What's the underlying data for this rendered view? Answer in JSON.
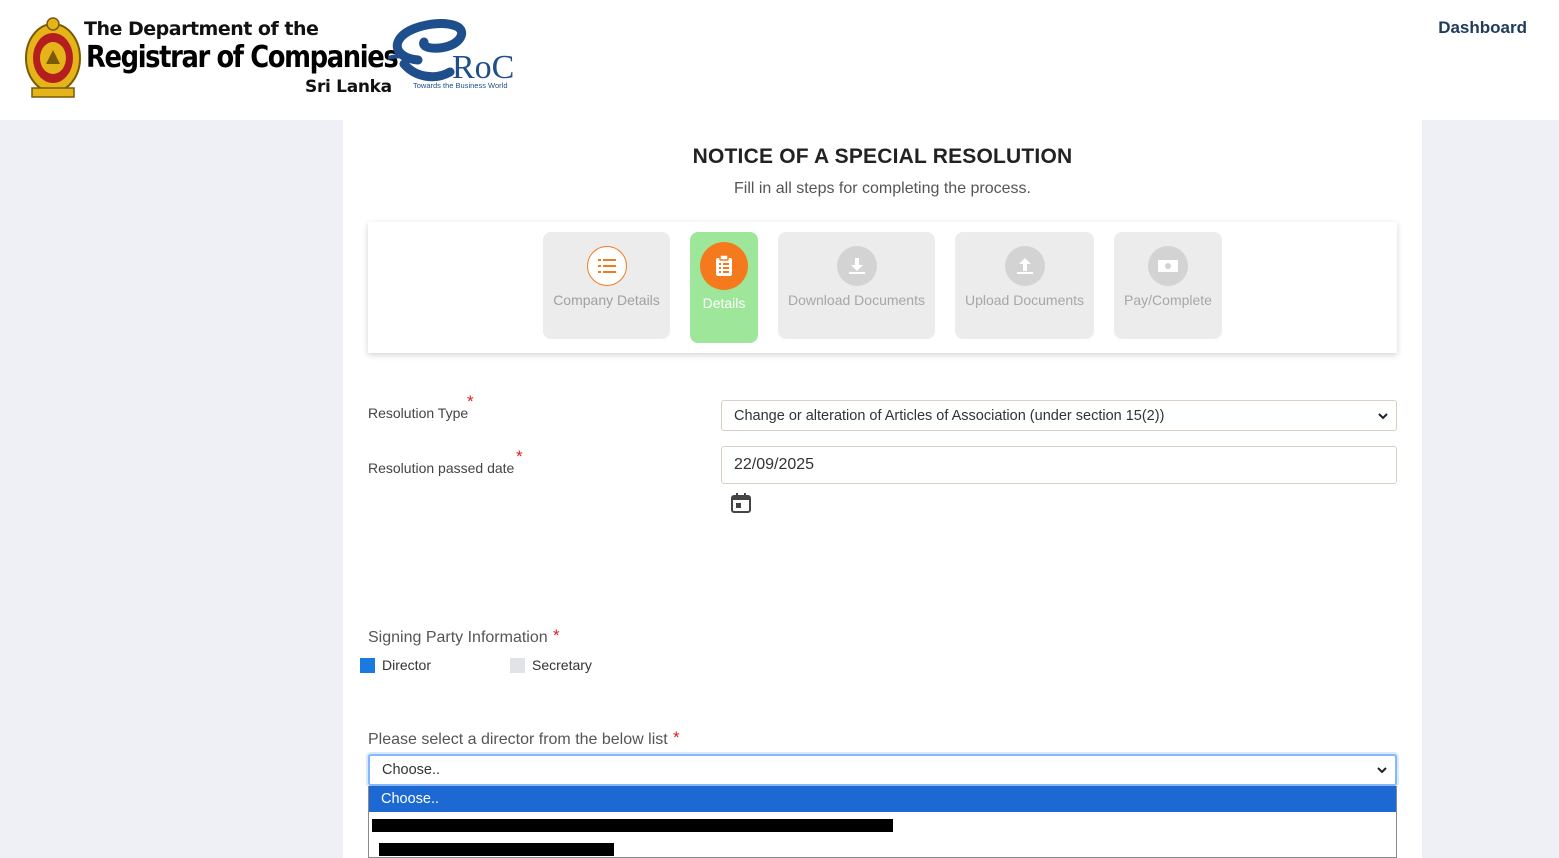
{
  "header": {
    "dept_line1": "The Department of the",
    "dept_line2": "Registrar of Companies",
    "dept_line3": "Sri Lanka",
    "eroc_brand": "RoC",
    "eroc_tagline": "Towards the Business World",
    "dashboard_label": "Dashboard"
  },
  "page": {
    "title": "NOTICE OF A SPECIAL RESOLUTION",
    "subtitle": "Fill in all steps for completing the process."
  },
  "steps": [
    {
      "label": "Company Details",
      "icon": "list-icon",
      "state": "done"
    },
    {
      "label": "Details",
      "icon": "clipboard-icon",
      "state": "active"
    },
    {
      "label": "Download Documents",
      "icon": "download-icon",
      "state": "pending"
    },
    {
      "label": "Upload Documents",
      "icon": "upload-icon",
      "state": "pending"
    },
    {
      "label": "Pay/Complete",
      "icon": "money-icon",
      "state": "pending"
    }
  ],
  "form": {
    "resolution_type_label": "Resolution Type",
    "resolution_type_value": "Change or alteration of Articles of Association (under section 15(2))",
    "resolution_date_label": "Resolution passed date",
    "resolution_date_value": "22/09/2025",
    "required_mark": "*",
    "signing_party_label": "Signing Party Information",
    "signing_options": [
      {
        "label": "Director",
        "checked": true
      },
      {
        "label": "Secretary",
        "checked": false
      }
    ],
    "director_select_label": "Please select a director from the below list",
    "director_select_value": "Choose..",
    "director_options": [
      "Choose.."
    ]
  },
  "colors": {
    "accent_orange": "#f57a1d",
    "active_step_bg": "#9ee79a",
    "selected_option_bg": "#1c69d3",
    "checkbox_checked": "#1a7ae0",
    "required_red": "#e01b1b",
    "dashboard_text": "#213b5c"
  }
}
